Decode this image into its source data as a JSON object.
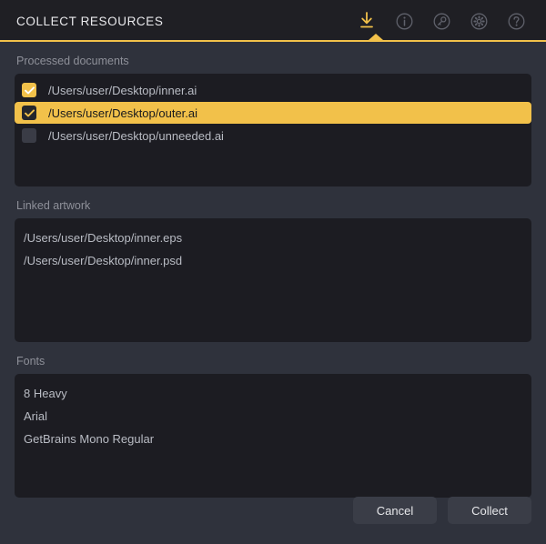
{
  "header": {
    "title": "COLLECT RESOURCES",
    "accent_color": "#f2c14a",
    "icons": [
      {
        "name": "download-icon",
        "label": "Collect",
        "active": true
      },
      {
        "name": "info-icon",
        "label": "Info",
        "active": false
      },
      {
        "name": "key-icon",
        "label": "License",
        "active": false
      },
      {
        "name": "gear-icon",
        "label": "Settings",
        "active": false
      },
      {
        "name": "help-icon",
        "label": "Help",
        "active": false
      }
    ]
  },
  "sections": {
    "processed_documents": {
      "label": "Processed documents",
      "rows": [
        {
          "path": "/Users/user/Desktop/inner.ai",
          "checked": true,
          "selected": false
        },
        {
          "path": "/Users/user/Desktop/outer.ai",
          "checked": true,
          "selected": true
        },
        {
          "path": "/Users/user/Desktop/unneeded.ai",
          "checked": false,
          "selected": false
        }
      ]
    },
    "linked_artwork": {
      "label": "Linked artwork",
      "rows": [
        "/Users/user/Desktop/inner.eps",
        "/Users/user/Desktop/inner.psd"
      ]
    },
    "fonts": {
      "label": "Fonts",
      "rows": [
        "8 Heavy",
        "Arial",
        "GetBrains Mono Regular"
      ]
    }
  },
  "footer": {
    "cancel_label": "Cancel",
    "collect_label": "Collect"
  }
}
